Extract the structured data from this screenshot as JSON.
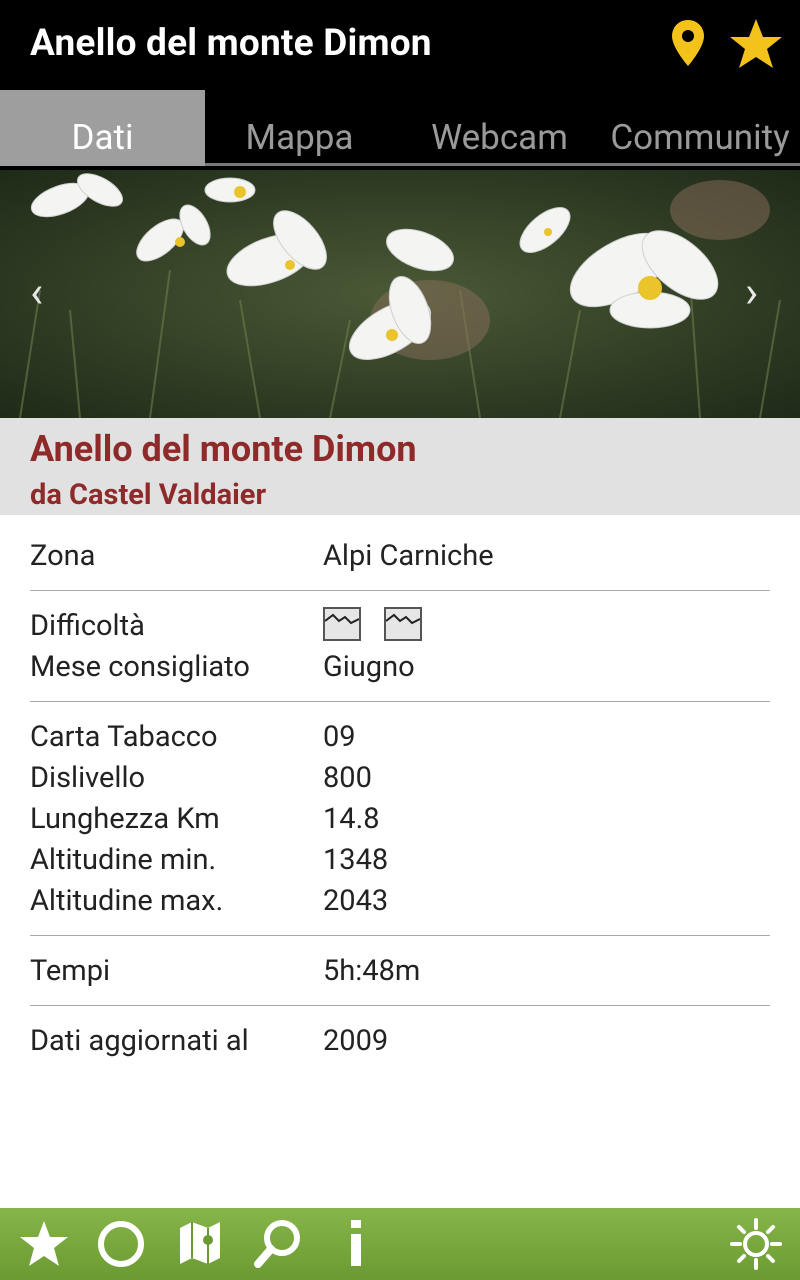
{
  "app": {
    "title": "Anello del monte Dimon",
    "top_icons": [
      "map-pin-icon",
      "star-icon"
    ],
    "accent_color": "#8e2a2a",
    "top_bar_color": "#000000",
    "bottom_bar_color": "#7aa83f"
  },
  "tabs": [
    {
      "label": "Dati",
      "active": true
    },
    {
      "label": "Mappa",
      "active": false
    },
    {
      "label": "Webcam",
      "active": false
    },
    {
      "label": "Community",
      "active": false
    }
  ],
  "route": {
    "title": "Anello del monte Dimon",
    "subtitle": "da Castel Valdaier"
  },
  "details": {
    "zona_label": "Zona",
    "zona_value": "Alpi Carniche",
    "difficolta_label": "Difficoltà",
    "difficolta_icons": [
      "mountain-difficulty-icon",
      "mountain-difficulty-icon"
    ],
    "mese_label": "Mese consigliato",
    "mese_value": "Giugno",
    "carta_label": "Carta Tabacco",
    "carta_value": "09",
    "dislivello_label": "Dislivello",
    "dislivello_value": "800",
    "lunghezza_label": "Lunghezza Km",
    "lunghezza_value": "14.8",
    "alt_min_label": "Altitudine min.",
    "alt_min_value": "1348",
    "alt_max_label": "Altitudine max.",
    "alt_max_value": "2043",
    "tempi_label": "Tempi",
    "tempi_value": "5h:48m",
    "aggiornati_label": "Dati aggiornati al",
    "aggiornati_value": "2009"
  },
  "bottom_bar_icons": [
    "star-icon",
    "circle-icon",
    "map-icon",
    "search-icon",
    "info-icon",
    "settings-icon"
  ]
}
